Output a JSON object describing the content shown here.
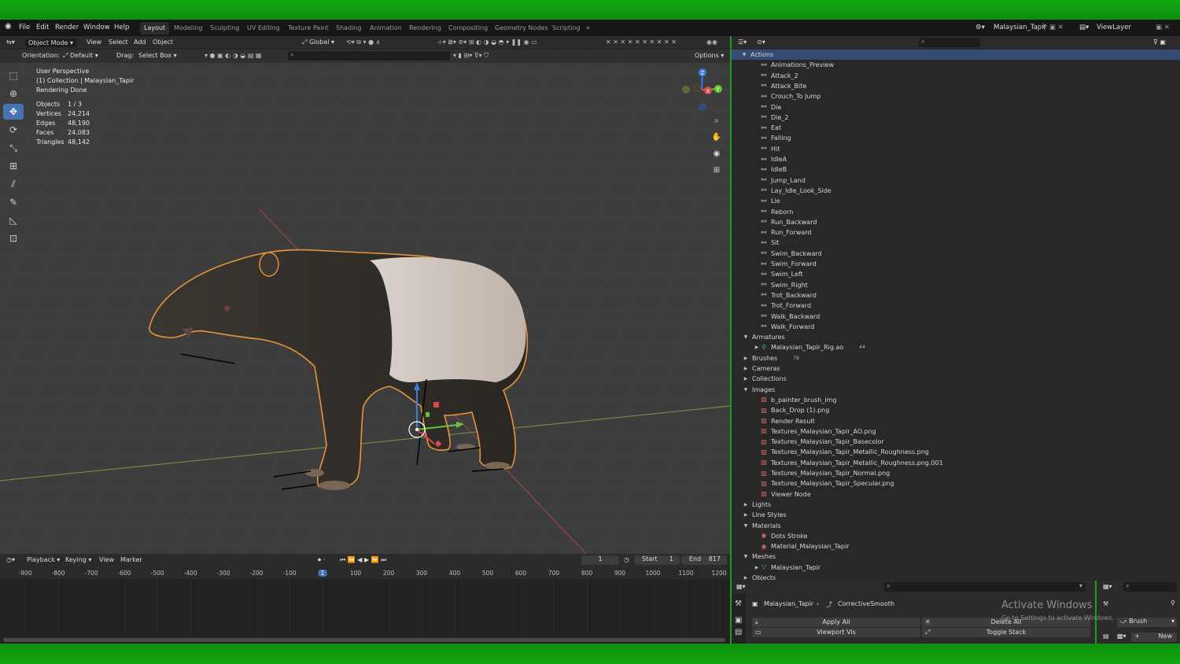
{
  "menu": [
    "File",
    "Edit",
    "Render",
    "Window",
    "Help"
  ],
  "workspaces": [
    {
      "label": "Layout",
      "active": true
    },
    {
      "label": "Modeling"
    },
    {
      "label": "Sculpting"
    },
    {
      "label": "UV Editing"
    },
    {
      "label": "Texture Paint"
    },
    {
      "label": "Shading"
    },
    {
      "label": "Animation"
    },
    {
      "label": "Rendering"
    },
    {
      "label": "Compositing"
    },
    {
      "label": "Geometry Nodes"
    },
    {
      "label": "Scripting"
    }
  ],
  "add_workspace": "+",
  "scene_name": "Malaysian_Tapir",
  "view_layer": "ViewLayer",
  "viewport_header": {
    "mode": "Object Mode",
    "view": "View",
    "select": "Select",
    "add": "Add",
    "object": "Object",
    "transform_orientation": "Global",
    "options": "Options"
  },
  "viewport_subheader": {
    "orientation_label": "Orientation:",
    "orientation_value": "Default",
    "drag_label": "Drag:",
    "drag_value": "Select Box"
  },
  "overlay": {
    "perspective": "User Perspective",
    "collection": "(1) Collection | Malaysian_Tapir",
    "status": "Rendering Done",
    "stats": [
      {
        "label": "Objects",
        "value": "1 / 3"
      },
      {
        "label": "Vertices",
        "value": "24,214"
      },
      {
        "label": "Edges",
        "value": "48,190"
      },
      {
        "label": "Faces",
        "value": "24,083"
      },
      {
        "label": "Triangles",
        "value": "48,142"
      }
    ]
  },
  "gizmo": {
    "z": "Z",
    "y": "Y",
    "x": "X"
  },
  "timeline": {
    "playback": "Playback",
    "keying": "Keying",
    "view": "View",
    "marker": "Marker",
    "current_frame": "1",
    "start_label": "Start",
    "start": "1",
    "end_label": "End",
    "end": "817",
    "ticks": [
      "-900",
      "-800",
      "-700",
      "-600",
      "-500",
      "-400",
      "-300",
      "-200",
      "-100",
      "1",
      "100",
      "200",
      "300",
      "400",
      "500",
      "600",
      "700",
      "800",
      "900",
      "1000",
      "1100",
      "1200"
    ]
  },
  "outliner": {
    "rows": [
      {
        "label": "Actions",
        "level": 0,
        "expand": "open",
        "selected": true,
        "icon": ""
      },
      {
        "label": "Animations_Preview",
        "level": 2,
        "icon": "action-icon"
      },
      {
        "label": "Attack_2",
        "level": 2,
        "icon": "action-icon"
      },
      {
        "label": "Attack_Bite",
        "level": 2,
        "icon": "action-icon"
      },
      {
        "label": "Crouch_To Jump",
        "level": 2,
        "icon": "action-icon"
      },
      {
        "label": "Die",
        "level": 2,
        "icon": "action-icon"
      },
      {
        "label": "Die_2",
        "level": 2,
        "icon": "action-icon"
      },
      {
        "label": "Eat",
        "level": 2,
        "icon": "action-icon"
      },
      {
        "label": "Falling",
        "level": 2,
        "icon": "action-icon"
      },
      {
        "label": "Hit",
        "level": 2,
        "icon": "action-icon"
      },
      {
        "label": "IdleA",
        "level": 2,
        "icon": "action-icon"
      },
      {
        "label": "IdleB",
        "level": 2,
        "icon": "action-icon"
      },
      {
        "label": "Jump_Land",
        "level": 2,
        "icon": "action-icon"
      },
      {
        "label": "Lay_Idle_Look_Side",
        "level": 2,
        "icon": "action-icon"
      },
      {
        "label": "Lie",
        "level": 2,
        "icon": "action-icon"
      },
      {
        "label": "Reborn",
        "level": 2,
        "icon": "action-icon"
      },
      {
        "label": "Run_Backward",
        "level": 2,
        "icon": "action-icon"
      },
      {
        "label": "Run_Forward",
        "level": 2,
        "icon": "action-icon"
      },
      {
        "label": "Sit",
        "level": 2,
        "icon": "action-icon"
      },
      {
        "label": "Swim_Backward",
        "level": 2,
        "icon": "action-icon"
      },
      {
        "label": "Swim_Forward",
        "level": 2,
        "icon": "action-icon"
      },
      {
        "label": "Swim_Left",
        "level": 2,
        "icon": "action-icon"
      },
      {
        "label": "Swim_Right",
        "level": 2,
        "icon": "action-icon"
      },
      {
        "label": "Trot_Backward",
        "level": 2,
        "icon": "action-icon"
      },
      {
        "label": "Trot_Forward",
        "level": 2,
        "icon": "action-icon"
      },
      {
        "label": "Walk_Backward",
        "level": 2,
        "icon": "action-icon"
      },
      {
        "label": "Walk_Forward",
        "level": 2,
        "icon": "action-icon"
      },
      {
        "label": "Armatures",
        "level": 1,
        "expand": "open",
        "icon": ""
      },
      {
        "label": "Malaysian_Tapir_Rig.ao",
        "level": 2,
        "expand": "closed",
        "icon": "armature-icon",
        "extra": "44"
      },
      {
        "label": "Brushes",
        "level": 1,
        "expand": "closed",
        "icon": "",
        "extra": "79"
      },
      {
        "label": "Cameras",
        "level": 1,
        "expand": "closed",
        "icon": ""
      },
      {
        "label": "Collections",
        "level": 1,
        "expand": "closed",
        "icon": ""
      },
      {
        "label": "Images",
        "level": 1,
        "expand": "open",
        "icon": ""
      },
      {
        "label": "b_painter_brush_img",
        "level": 2,
        "icon": "image-icon"
      },
      {
        "label": "Back_Drop (1).png",
        "level": 2,
        "icon": "image-icon"
      },
      {
        "label": "Render Result",
        "level": 2,
        "icon": "image-icon"
      },
      {
        "label": "Textures_Malaysian_Tapir_AO.png",
        "level": 2,
        "icon": "image-icon"
      },
      {
        "label": "Textures_Malaysian_Tapir_Basecolor",
        "level": 2,
        "icon": "image-icon"
      },
      {
        "label": "Textures_Malaysian_Tapir_Metallic_Roughness.png",
        "level": 2,
        "icon": "image-icon"
      },
      {
        "label": "Textures_Malaysian_Tapir_Metallic_Roughness.png.001",
        "level": 2,
        "icon": "image-icon"
      },
      {
        "label": "Textures_Malaysian_Tapir_Normal.png",
        "level": 2,
        "icon": "image-icon"
      },
      {
        "label": "Textures_Malaysian_Tapir_Specular.png",
        "level": 2,
        "icon": "image-icon"
      },
      {
        "label": "Viewer Node",
        "level": 2,
        "icon": "image-icon"
      },
      {
        "label": "Lights",
        "level": 1,
        "expand": "closed",
        "icon": ""
      },
      {
        "label": "Line Styles",
        "level": 1,
        "expand": "closed",
        "icon": ""
      },
      {
        "label": "Materials",
        "level": 1,
        "expand": "open",
        "icon": ""
      },
      {
        "label": "Dots Stroke",
        "level": 2,
        "icon": "material-icon"
      },
      {
        "label": "Material_Malaysian_Tapir",
        "level": 2,
        "icon": "material-icon"
      },
      {
        "label": "Meshes",
        "level": 1,
        "expand": "open",
        "icon": ""
      },
      {
        "label": "Malaysian_Tapir",
        "level": 2,
        "expand": "closed",
        "icon": "mesh-icon"
      },
      {
        "label": "Objects",
        "level": 1,
        "expand": "closed",
        "icon": ""
      }
    ]
  },
  "properties": {
    "object": "Malaysian_Tapir",
    "modifier": "CorrectiveSmooth",
    "apply_all": "Apply All",
    "delete_all": "Delete All",
    "viewport_vis": "Viewport Vis",
    "toggle_stack": "Toggle Stack"
  },
  "tool_props": {
    "brush": "Brush",
    "new": "New"
  },
  "watermark": {
    "title": "Activate Windows",
    "sub": "Go to Settings to activate Windows."
  },
  "colors": {
    "selection": "#344c73",
    "active_tool": "#4772b3",
    "outline": "#e8953a",
    "green_frame": "#12a812"
  }
}
